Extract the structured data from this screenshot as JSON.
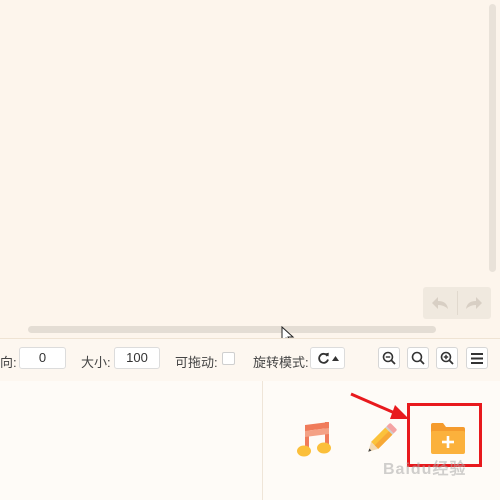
{
  "toolbar": {
    "direction_label": "向:",
    "direction_value": "0",
    "size_label": "大小:",
    "size_value": "100",
    "draggable_label": "可拖动:",
    "rotate_label": "旋转模式:"
  },
  "icons": {
    "undo": "undo-arrow-icon",
    "redo": "redo-arrow-icon",
    "rotate": "rotate-icon",
    "zoom_out": "zoom-out-icon",
    "zoom_reset": "zoom-search-icon",
    "zoom_in": "zoom-in-icon",
    "menu": "hamburger-menu-icon",
    "music": "music-note-icon",
    "pencil": "pencil-icon",
    "add_folder": "add-folder-icon"
  },
  "watermark": "Baidu经验",
  "colors": {
    "background": "#fdf5ec",
    "accent_border": "#f0cf99",
    "highlight": "#e8191d",
    "folder": "#f7a836",
    "music": "#f07b5a"
  }
}
